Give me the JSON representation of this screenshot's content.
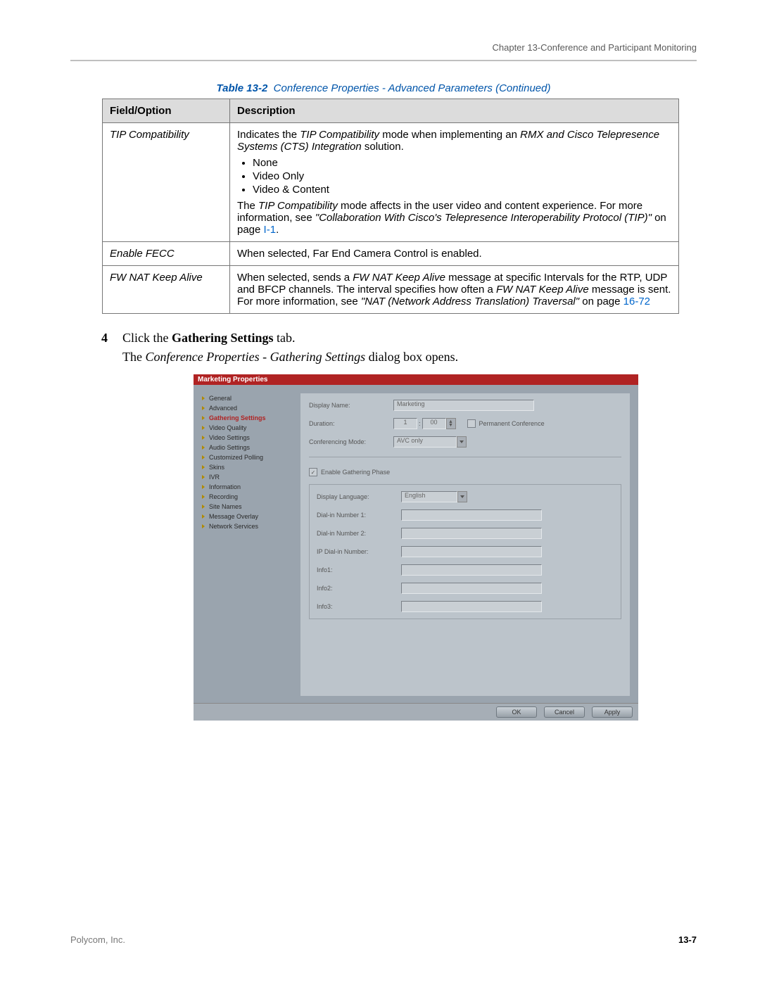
{
  "header": {
    "chapter": "Chapter 13-Conference and Participant Monitoring"
  },
  "table_caption_prefix": "Table 13-2",
  "table_caption_rest": "Conference Properties - Advanced Parameters (Continued)",
  "columns": {
    "c1": "Field/Option",
    "c2": "Description"
  },
  "rows": {
    "r1": {
      "field": "TIP Compatibility",
      "desc_p1a": "Indicates the ",
      "desc_p1b": "TIP Compatibility",
      "desc_p1c": " mode when implementing an ",
      "desc_p1d": "RMX and Cisco Telepresence Systems (CTS) Integration",
      "desc_p1e": " solution.",
      "bul1": "None",
      "bul2": "Video Only",
      "bul3": "Video & Content",
      "desc_p2a": "The ",
      "desc_p2b": "TIP Compatibility",
      "desc_p2c": " mode affects in the user video and content experience. For more information, see ",
      "desc_p2d": "\"Collaboration With Cisco's Telepresence Interoperability Protocol (TIP)\"",
      "desc_p2e": " on page ",
      "desc_link": "I-1",
      "desc_p2f": "."
    },
    "r2": {
      "field": "Enable FECC",
      "desc": "When selected, Far End Camera Control is enabled."
    },
    "r3": {
      "field": "FW NAT Keep Alive",
      "desc_a": "When selected, sends a ",
      "desc_b": "FW NAT Keep Alive",
      "desc_c": " message at specific Intervals for the RTP, UDP and BFCP channels. The interval specifies how often a ",
      "desc_d": "FW NAT Keep Alive",
      "desc_e": " message is sent. For more information, see ",
      "desc_f": "\"NAT (Network Address Translation) Traversal\"",
      "desc_g": " on page ",
      "desc_link": "16-72"
    }
  },
  "step": {
    "num": "4",
    "text_a": "Click the ",
    "text_b": "Gathering Settings",
    "text_c": " tab.",
    "sub_a": "The ",
    "sub_b": "Conference Properties - Gathering Settings",
    "sub_c": " dialog box opens."
  },
  "dialog": {
    "title": "Marketing Properties",
    "nav": [
      "General",
      "Advanced",
      "Gathering Settings",
      "Video Quality",
      "Video Settings",
      "Audio Settings",
      "Customized Polling",
      "Skins",
      "IVR",
      "Information",
      "Recording",
      "Site Names",
      "Message Overlay",
      "Network Services"
    ],
    "nav_selected_index": 2,
    "labels": {
      "display_name": "Display Name:",
      "duration": "Duration:",
      "permanent": "Permanent Conference",
      "conf_mode": "Conferencing Mode:",
      "enable_gather": "Enable Gathering Phase",
      "disp_lang": "Display Language:",
      "dial1": "Dial-in Number 1:",
      "dial2": "Dial-in Number 2:",
      "ipdial": "IP Dial-in Number:",
      "info1": "Info1:",
      "info2": "Info2:",
      "info3": "Info3:"
    },
    "values": {
      "display_name": "Marketing",
      "duration_h": "1",
      "duration_m": "00",
      "conf_mode": "AVC only",
      "disp_lang": "English"
    },
    "buttons": {
      "ok": "OK",
      "cancel": "Cancel",
      "apply": "Apply"
    }
  },
  "footer": {
    "left": "Polycom, Inc.",
    "right": "13-7"
  }
}
